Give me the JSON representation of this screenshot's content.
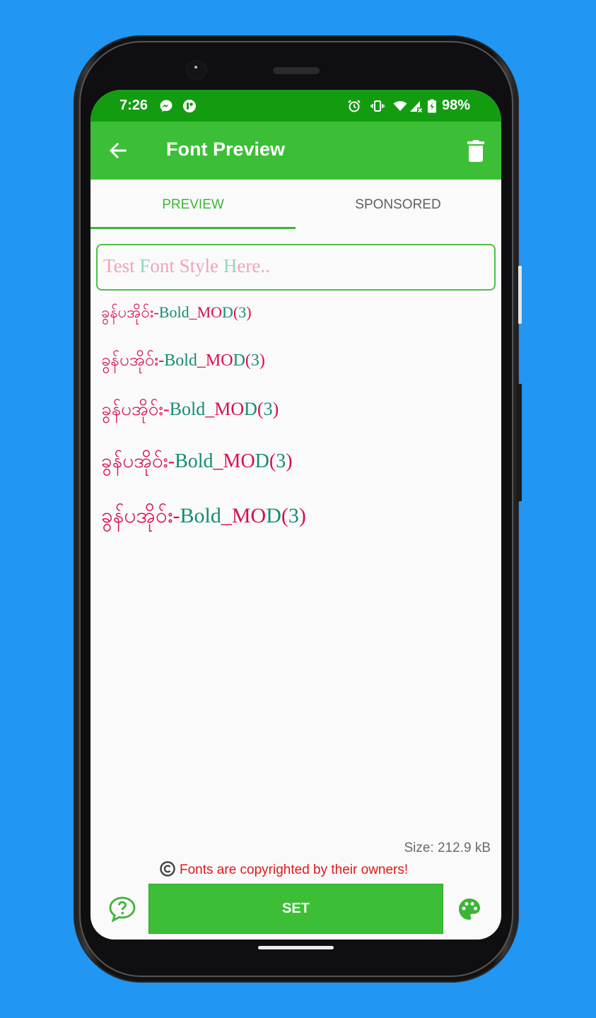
{
  "status_bar": {
    "time": "7:26",
    "left_icons": [
      "messenger-icon",
      "app-notification-icon"
    ],
    "right_icons": [
      "alarm-icon",
      "vibrate-icon",
      "wifi-icon",
      "cell-signal-off-icon",
      "battery-charging-icon"
    ],
    "battery": "98%"
  },
  "app_bar": {
    "title": "Font Preview",
    "back_icon": "arrow-left-icon",
    "action_icon": "trash-icon"
  },
  "tabs": [
    {
      "label": "PREVIEW",
      "active": true
    },
    {
      "label": "SPONSORED",
      "active": false
    }
  ],
  "test_input": {
    "value": "",
    "placeholder_segments": [
      {
        "text": "Test ",
        "color": "pink"
      },
      {
        "text": "F",
        "color": "teal"
      },
      {
        "text": "ont Style ",
        "color": "pink"
      },
      {
        "text": "H",
        "color": "teal"
      },
      {
        "text": "ere..",
        "color": "pink"
      }
    ],
    "placeholder": "Test Font Style Here.."
  },
  "preview": {
    "text": "ခွန်ပအိုဝ်း-Bold_MOD(3)",
    "segments": [
      {
        "text": "ခွန်ပအိုဝ်း-",
        "color": "crimson"
      },
      {
        "text": "Bold",
        "color": "teal"
      },
      {
        "text": "_MO",
        "color": "crimson"
      },
      {
        "text": "D",
        "color": "teal"
      },
      {
        "text": "(",
        "color": "crimson"
      },
      {
        "text": "3",
        "color": "teal"
      },
      {
        "text": ")",
        "color": "crimson"
      }
    ],
    "lines": [
      {
        "size_step": 1
      },
      {
        "size_step": 2
      },
      {
        "size_step": 3
      },
      {
        "size_step": 4
      },
      {
        "size_step": 5
      }
    ]
  },
  "footer": {
    "size_text": "Size: 212.9 kB",
    "copyright_text": "Fonts are copyrighted by their owners!",
    "set_label": "SET",
    "help_icon": "help-bubble-icon",
    "theme_icon": "palette-icon"
  },
  "colors": {
    "status_bar": "#139c10",
    "app_bar": "#3cbf36",
    "accent": "#3cb536",
    "crimson": "#d6104e",
    "teal": "#148c74",
    "placeholder_pink": "#f2a3b8",
    "placeholder_teal": "#93d4c4",
    "warning_red": "#e01818",
    "background": "#2196F3"
  }
}
